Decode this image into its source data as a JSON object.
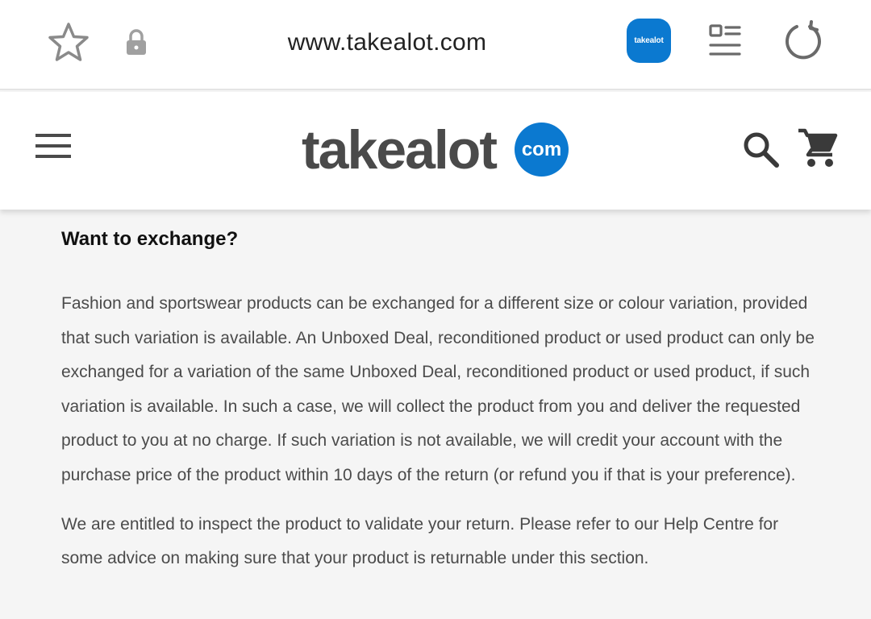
{
  "browser": {
    "url": "www.takealot.com",
    "tab_icon_label": "takealot",
    "icons": [
      "star-icon",
      "lock-icon",
      "tab-switcher-icon",
      "reader-mode-icon",
      "reload-icon"
    ]
  },
  "header": {
    "logo_word": "takealot",
    "logo_badge": "com",
    "icons": [
      "menu-icon",
      "search-icon",
      "cart-icon"
    ],
    "brand_color": "#0b79d0"
  },
  "content": {
    "heading": "Want to exchange?",
    "paragraph1": "Fashion and sportswear products can be exchanged for a different size or colour variation, provided that such variation is available. An Unboxed Deal, reconditioned product or used product can only be exchanged for a variation of the same Unboxed Deal, reconditioned product or used product, if such variation is available. In such a case, we will collect the product from you and deliver the requested product to you at no charge. If such variation is not available, we will credit your account with the purchase price of the product within 10 days of the return (or refund you if that is your preference).",
    "paragraph2": "We are entitled to inspect the product to validate your return. Please refer to our Help Centre for some advice on making sure that your product is returnable under this section."
  }
}
